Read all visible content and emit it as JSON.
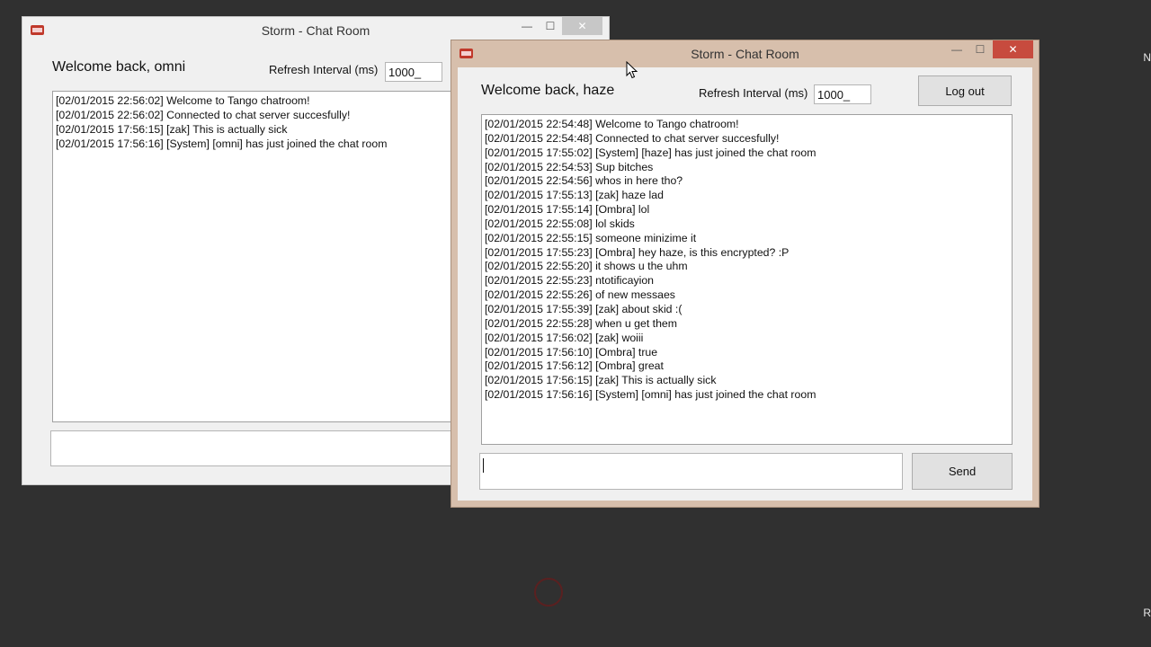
{
  "desktop": {
    "edge_label_top": "N",
    "edge_label_bottom": "R"
  },
  "back_window": {
    "title": "Storm - Chat Room",
    "welcome": "Welcome back, omni",
    "refresh_label": "Refresh Interval (ms)",
    "refresh_value": "1000_",
    "controls": {
      "minimize": "—",
      "maximize": "☐",
      "close": "✕"
    },
    "messages": [
      "[02/01/2015 22:56:02] Welcome to Tango chatroom!",
      "[02/01/2015 22:56:02] Connected to chat server succesfully!",
      "[02/01/2015 17:56:15] [zak] This is actually sick",
      "[02/01/2015 17:56:16] [System] [omni] has just joined the chat room"
    ],
    "message_input_value": ""
  },
  "front_window": {
    "title": "Storm - Chat Room",
    "welcome": "Welcome back, haze",
    "refresh_label": "Refresh Interval (ms)",
    "refresh_value": "1000_",
    "logout_label": "Log out",
    "send_label": "Send",
    "controls": {
      "minimize": "—",
      "maximize": "☐",
      "close": "✕"
    },
    "messages": [
      "[02/01/2015 22:54:48] Welcome to Tango chatroom!",
      "[02/01/2015 22:54:48] Connected to chat server succesfully!",
      "[02/01/2015 17:55:02] [System] [haze] has just joined the chat room",
      "[02/01/2015 22:54:53] Sup bitches",
      "[02/01/2015 22:54:56] whos in here tho?",
      "[02/01/2015 17:55:13] [zak] haze lad",
      "[02/01/2015 17:55:14] [Ombra] lol",
      "[02/01/2015 22:55:08] lol skids",
      "[02/01/2015 22:55:15] someone minizime it",
      "[02/01/2015 17:55:23] [Ombra] hey haze, is this encrypted? :P",
      "[02/01/2015 22:55:20] it shows u the uhm",
      "[02/01/2015 22:55:23] ntotificayion",
      "[02/01/2015 22:55:26] of new messaes",
      "[02/01/2015 17:55:39] [zak] about skid :(",
      "[02/01/2015 22:55:28] when u get them",
      "[02/01/2015 17:56:02] [zak] woiii",
      "[02/01/2015 17:56:10] [Ombra] true",
      "[02/01/2015 17:56:12] [Ombra] great",
      "[02/01/2015 17:56:15] [zak] This is actually sick",
      "[02/01/2015 17:56:16] [System] [omni] has just joined the chat room"
    ],
    "message_input_value": ""
  },
  "colors": {
    "desktop": "#303030",
    "active_title_bar": "#d7bfac",
    "active_close": "#c74b3e",
    "inactive_title_bar": "#f0f0f0",
    "busy_spinner": "#5a2020"
  },
  "icons": [
    "app-icon",
    "minimize-icon",
    "maximize-icon",
    "close-icon",
    "mouse-cursor-icon",
    "busy-spinner-icon"
  ]
}
